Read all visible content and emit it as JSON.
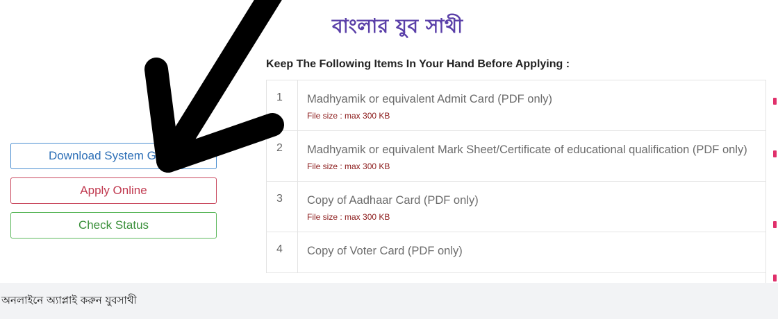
{
  "header": {
    "title": "বাংলার যুব সাথী"
  },
  "sidebar": {
    "download_label": "Download System Guide",
    "apply_label": "Apply Online",
    "status_label": "Check Status"
  },
  "main": {
    "heading": "Keep The Following Items In Your Hand Before Applying :",
    "items": [
      {
        "num": "1",
        "name": "Madhyamik or equivalent Admit Card (PDF only)",
        "size": "File size : max 300 KB"
      },
      {
        "num": "2",
        "name": "Madhyamik or equivalent Mark Sheet/Certificate of educational qualification (PDF only)",
        "size": "File size : max 300 KB"
      },
      {
        "num": "3",
        "name": "Copy of Aadhaar Card (PDF only)",
        "size": "File size : max 300 KB"
      },
      {
        "num": "4",
        "name": "Copy of Voter Card (PDF only)",
        "size": ""
      }
    ]
  },
  "caption": {
    "text": "অনলাইনে অ্যাপ্লাই করুন যুবসাথী"
  },
  "colors": {
    "title": "#5a3fa8",
    "download": "#2d6fb7",
    "apply": "#c0394f",
    "status": "#3a8f3a",
    "file_size": "#8b1a1a",
    "arrow": "#000000"
  },
  "icons": {
    "annotation": "arrow-pointing-down-left-icon"
  }
}
